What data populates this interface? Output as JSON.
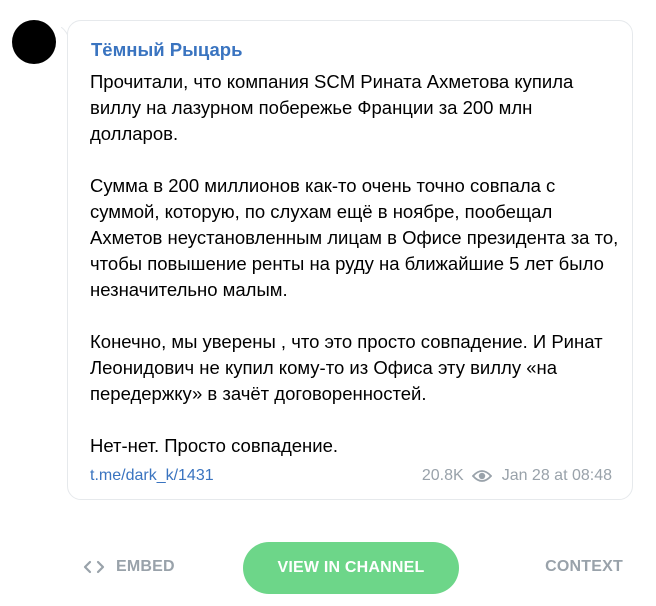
{
  "channel": {
    "name": "Тёмный Рыцарь"
  },
  "message": {
    "paragraphs": [
      "Прочитали, что компания SCM Рината Ахметова купила виллу на лазурном побережье Франции за 200 млн долларов.",
      "Сумма в 200 миллионов как-то очень точно совпала с суммой, которую, по слухам ещё в ноябре, пообещал Ахметов неустановленным лицам в Офисе президента за то, чтобы повышение ренты на руду на ближайшие 5 лет было незначительно малым.",
      "Конечно, мы уверены , что это просто совпадение. И Ринат Леонидович не купил кому-то из Офиса эту виллу «на передержку» в зачёт договоренностей.",
      "Нет-нет. Просто совпадение."
    ],
    "link": "t.me/dark_k/1431",
    "views": "20.8K",
    "date": "Jan 28 at 08:48"
  },
  "footer": {
    "embed_label": "EMBED",
    "view_label": "VIEW IN CHANNEL",
    "context_label": "CONTEXT"
  },
  "icons": {
    "views": "eye-icon",
    "embed": "code-icon"
  },
  "colors": {
    "accent": "#3a74c0",
    "muted": "#99a2aa",
    "button": "#6dd689",
    "avatar": "#000000"
  }
}
